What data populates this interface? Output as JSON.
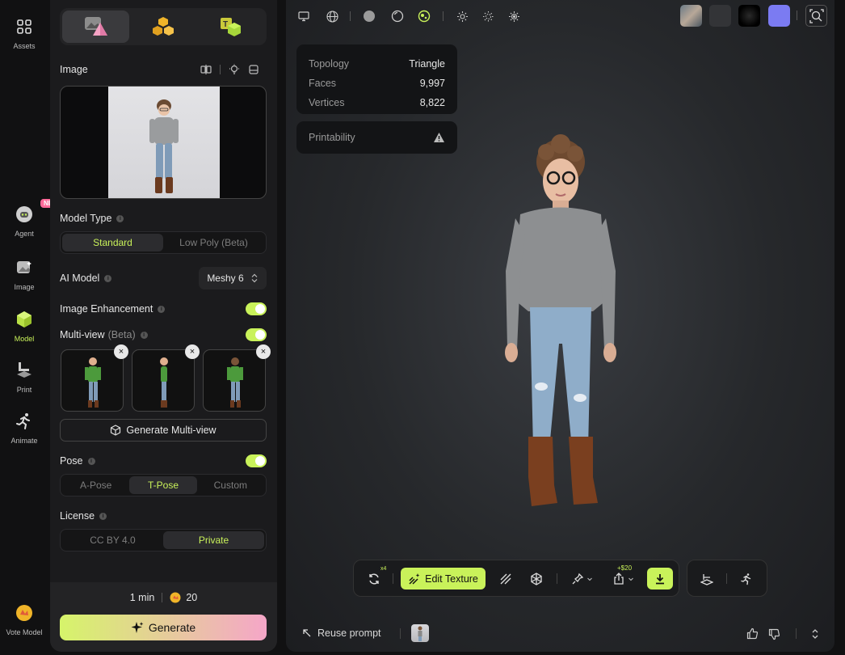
{
  "rail": {
    "items": [
      {
        "label": "Assets",
        "icon": "grid-icon"
      },
      {
        "label": "Agent",
        "icon": "agent-icon",
        "badge": "NEW"
      },
      {
        "label": "Image",
        "icon": "image-icon"
      },
      {
        "label": "Model",
        "icon": "cube-icon",
        "active": true
      },
      {
        "label": "Print",
        "icon": "print-icon"
      },
      {
        "label": "Animate",
        "icon": "running-icon"
      },
      {
        "label": "Vote Model",
        "icon": "vote-icon"
      }
    ]
  },
  "panel": {
    "image_title": "Image",
    "model_type": {
      "title": "Model Type",
      "options": [
        "Standard",
        "Low Poly (Beta)"
      ],
      "selected": "Standard"
    },
    "ai_model": {
      "title": "AI Model",
      "value": "Meshy 6"
    },
    "image_enhancement": {
      "title": "Image Enhancement",
      "enabled": true
    },
    "multiview": {
      "title": "Multi-view",
      "beta": "(Beta)",
      "enabled": true,
      "button": "Generate Multi-view"
    },
    "pose": {
      "title": "Pose",
      "enabled": true,
      "options": [
        "A-Pose",
        "T-Pose",
        "Custom"
      ],
      "selected": "T-Pose"
    },
    "license": {
      "title": "License",
      "options": [
        "CC BY 4.0",
        "Private"
      ],
      "selected": "Private"
    },
    "footer": {
      "time": "1 min",
      "credits": "20",
      "generate": "Generate"
    }
  },
  "viewport": {
    "stats": {
      "topology_label": "Topology",
      "topology_value": "Triangle",
      "faces_label": "Faces",
      "faces_value": "9,997",
      "vertices_label": "Vertices",
      "vertices_value": "8,822"
    },
    "printability": "Printability",
    "toolbar_bottom": {
      "remesh_badge": "x4",
      "edit_texture": "Edit Texture",
      "export_price": "+$20"
    },
    "reuse_prompt": "Reuse prompt"
  },
  "colors": {
    "accent": "#c9f25a",
    "pink": "#f5a6c8",
    "swatch_purple": "#7b7bf2"
  }
}
